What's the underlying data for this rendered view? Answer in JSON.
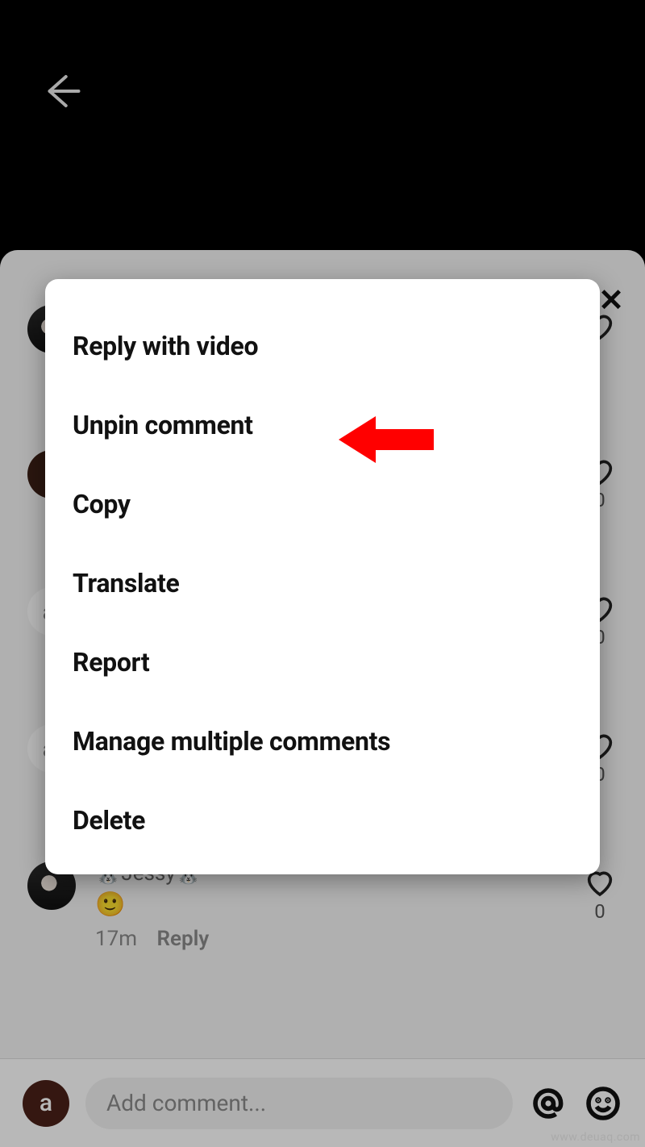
{
  "topbar": {
    "back_icon_name": "back-icon"
  },
  "sheet": {
    "close_glyph": "✕",
    "comments": [
      {
        "username": "🐰Jessy🐰",
        "text_emoji": "🙂",
        "time": "17m",
        "reply_label": "Reply",
        "like_count": "0"
      }
    ]
  },
  "input": {
    "me_avatar_letter": "a",
    "placeholder": "Add comment..."
  },
  "action_sheet": {
    "items": [
      "Reply with video",
      "Unpin comment",
      "Copy",
      "Translate",
      "Report",
      "Manage multiple comments",
      "Delete"
    ]
  },
  "watermark": "www.deuaq.com"
}
